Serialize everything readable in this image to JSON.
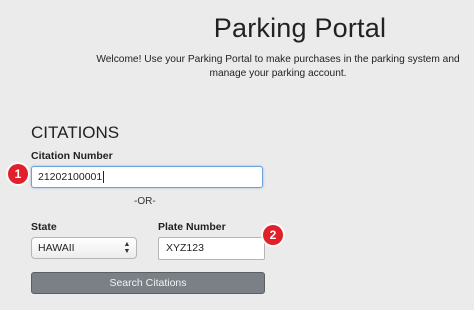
{
  "header": {
    "title": "Parking Portal",
    "welcome_line1": "Welcome! Use your Parking Portal to make purchases in the parking system and",
    "welcome_line2": "manage your parking account."
  },
  "citations": {
    "section_title": "CITATIONS",
    "citation_number_label": "Citation Number",
    "citation_number_value": "21202100001",
    "or_separator": "-OR-",
    "state_label": "State",
    "state_selected": "HAWAII",
    "plate_number_label": "Plate Number",
    "plate_number_value": "XYZ123",
    "search_button_label": "Search Citations"
  },
  "annotations": {
    "marker_1": "1",
    "marker_2": "2"
  },
  "colors": {
    "background": "#ebebeb",
    "focus_border": "#6aa3e0",
    "button_bg": "#7b8086",
    "marker_red": "#e0202a"
  }
}
